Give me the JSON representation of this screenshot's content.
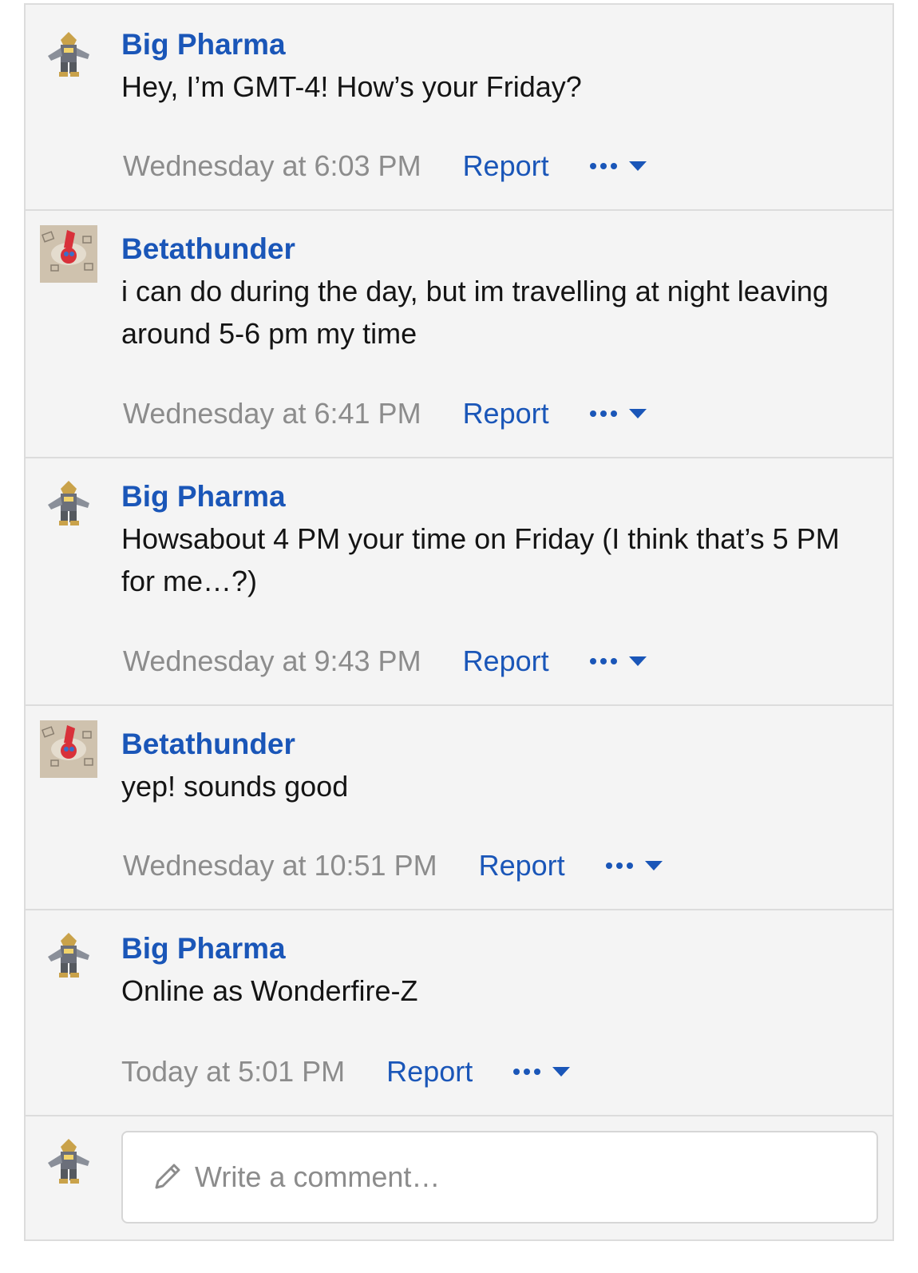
{
  "comments": [
    {
      "author": "Big Pharma",
      "avatar": "golurk-sprite-avatar",
      "text": "Hey, I’m GMT-4! How’s your Friday?",
      "time": "Wednesday at 6:03 PM",
      "report": "Report"
    },
    {
      "author": "Betathunder",
      "avatar": "rotom-photo-avatar",
      "text": "i can do during the day, but im travelling at night leaving around 5-6 pm my time",
      "time": "Wednesday at 6:41 PM",
      "report": "Report"
    },
    {
      "author": "Big Pharma",
      "avatar": "golurk-sprite-avatar",
      "text": "Howsabout 4 PM your time on Friday (I think that’s 5 PM for me…?)",
      "time": "Wednesday at 9:43 PM",
      "report": "Report"
    },
    {
      "author": "Betathunder",
      "avatar": "rotom-photo-avatar",
      "text": "yep! sounds good",
      "time": "Wednesday at 10:51 PM",
      "report": "Report"
    },
    {
      "author": "Big Pharma",
      "avatar": "golurk-sprite-avatar",
      "text": "Online as Wonderfire-Z",
      "time": "Today at 5:01 PM",
      "report": "Report"
    }
  ],
  "composer": {
    "placeholder": "Write a comment…",
    "icon": "pencil-icon"
  },
  "colors": {
    "link": "#1a56b8",
    "muted": "#8c8c8c",
    "panel": "#f4f4f4",
    "border": "#dcdcdc"
  }
}
